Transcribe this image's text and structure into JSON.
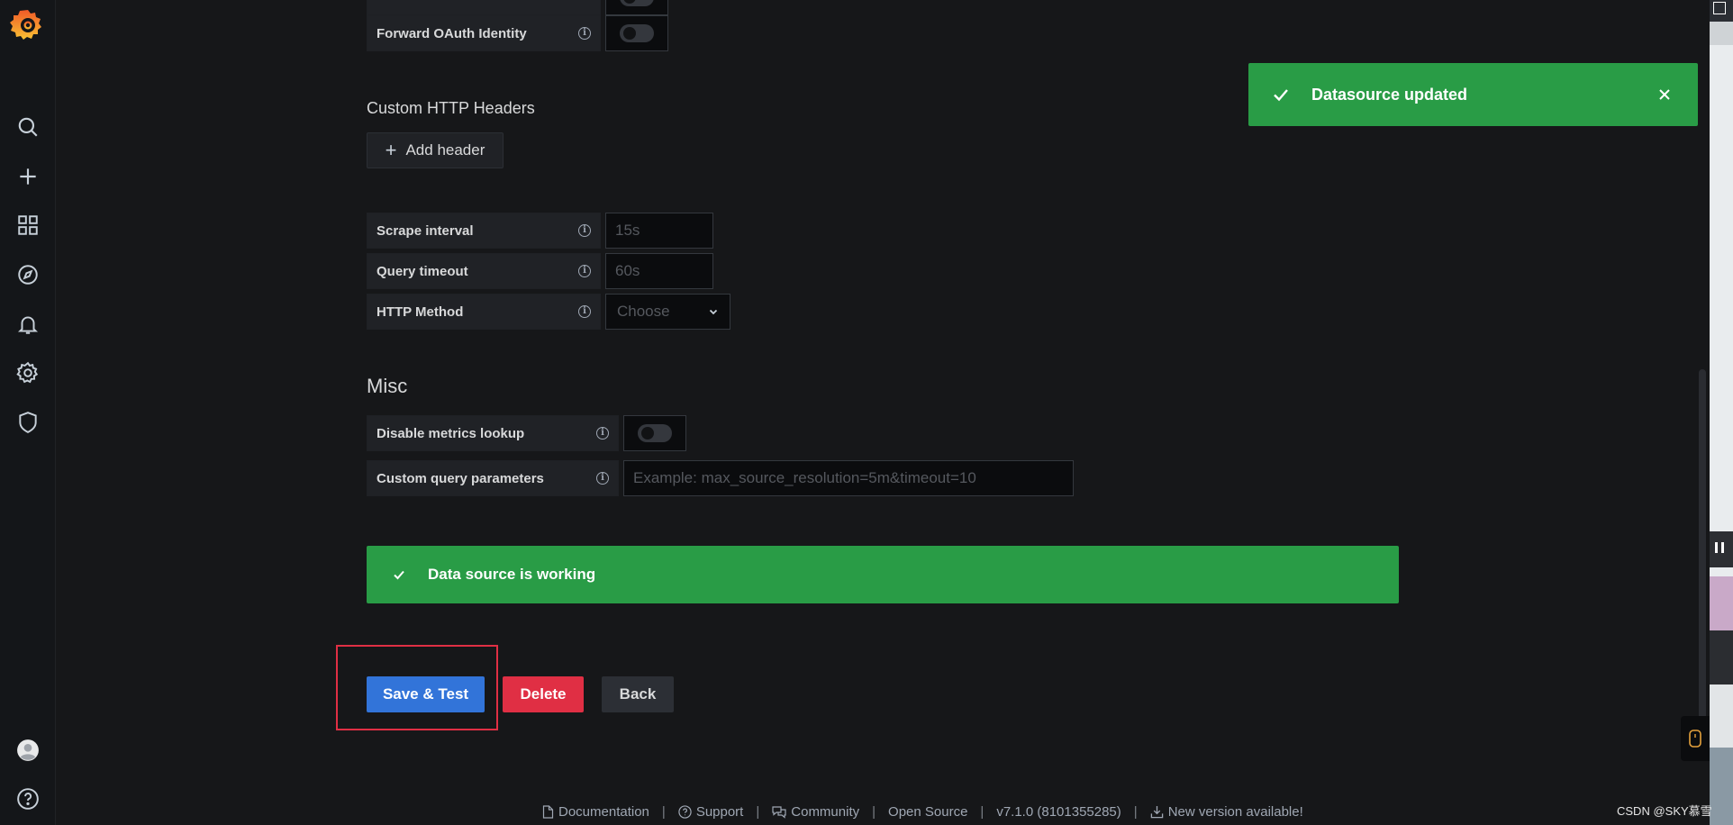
{
  "sidebar": {
    "icons": [
      "grafana-logo-icon",
      "search-icon",
      "plus-icon",
      "dashboards-icon",
      "explore-icon",
      "alerting-icon",
      "configuration-icon",
      "shield-icon",
      "avatar",
      "help-icon"
    ]
  },
  "settings": {
    "forward_oauth_label": "Forward OAuth Identity",
    "custom_headers_title": "Custom HTTP Headers",
    "add_header_label": "Add header",
    "scrape_interval_label": "Scrape interval",
    "scrape_interval_placeholder": "15s",
    "query_timeout_label": "Query timeout",
    "query_timeout_placeholder": "60s",
    "http_method_label": "HTTP Method",
    "http_method_placeholder": "Choose"
  },
  "misc": {
    "title": "Misc",
    "disable_metrics_label": "Disable metrics lookup",
    "custom_query_label": "Custom query parameters",
    "custom_query_placeholder": "Example: max_source_resolution=5m&timeout=10"
  },
  "alert": {
    "message": "Data source is working"
  },
  "buttons": {
    "save_test": "Save & Test",
    "delete": "Delete",
    "back": "Back"
  },
  "toast": {
    "message": "Datasource updated"
  },
  "footer": {
    "documentation": "Documentation",
    "support": "Support",
    "community": "Community",
    "open_source": "Open Source",
    "version": "v7.1.0 (8101355285)",
    "new_version": "New version available!"
  },
  "watermark": "CSDN @SKY慕雪",
  "colors": {
    "background": "#161719",
    "success": "#299c46",
    "primary": "#3274d9",
    "danger": "#e02f44",
    "highlight": "#e02f44"
  }
}
